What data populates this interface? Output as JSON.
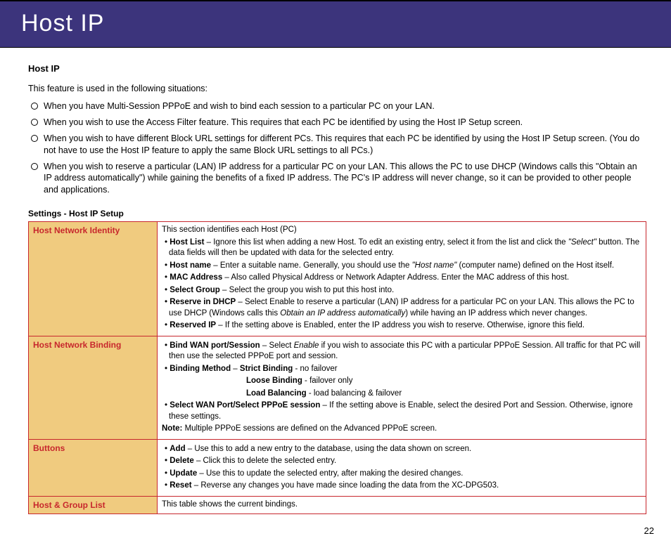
{
  "header": {
    "title": "Host IP"
  },
  "pageNumber": "22",
  "section": {
    "subhead": "Host IP",
    "intro": "This feature is used in the following situations:",
    "bullets": [
      "When you have Multi-Session PPPoE and wish to bind each session to a particular PC on your LAN.",
      "When you wish to use the Access Filter feature. This requires that each PC be identified by using the Host IP Setup screen.",
      "When you wish to have different Block URL settings for different PCs. This requires that each PC be identified by using the Host IP Setup screen. (You do not have to use the Host IP feature to apply the same Block URL settings to all PCs.)",
      "When you wish to reserve a particular (LAN) IP address for a particular PC on your LAN. This allows the PC to use DHCP (Windows calls this \"Obtain an IP address automatically\") while gaining the benefits of a fixed IP address. The PC's IP address will never change, so it can be provided to other people and applications."
    ],
    "tableTitle": "Settings - Host IP Setup"
  },
  "table": {
    "row1": {
      "label": "Host Network Identity",
      "lead": "This section identifies each Host (PC)",
      "hostList_label": "Host List",
      "hostList_sep": " – Ignore this list when adding a new Host. To edit an existing entry, select it from the list and click the ",
      "hostList_quote": "\"Select\"",
      "hostList_after": " button. The data fields will then be updated with data for the selected entry.",
      "hostName_label": "Host name",
      "hostName_sep": " – Enter a suitable name. Generally, you should use the ",
      "hostName_quote": "\"Host name\"",
      "hostName_after": " (computer name) defined on the Host itself.",
      "mac_label": "MAC Address",
      "mac_text": " – Also called Physical Address or Network Adapter Address. Enter the MAC address of this host.",
      "selGroup_label": "Select Group",
      "selGroup_text": " – Select the group you wish to put this host into.",
      "reserve_label": "Reserve in DHCP",
      "reserve_pre": " – Select Enable to reserve a particular (LAN) IP address for a particular PC on your LAN. This allows the PC to use DHCP (Windows calls this ",
      "reserve_italic": "Obtain an IP address automatically",
      "reserve_post": ") while having an IP address which never changes.",
      "reservedIP_label": "Reserved IP",
      "reservedIP_text": " – If the setting above is Enabled, enter the IP address you wish to reserve. Otherwise, ignore this field."
    },
    "row2": {
      "label": "Host Network Binding",
      "bind_label": "Bind WAN port/Session",
      "bind_pre": " – Select ",
      "bind_italic": "Enable",
      "bind_post": " if you wish to associate this PC with a particular PPPoE Session. All traffic for that PC will then use the selected PPPoE port and session.",
      "method_label": "Binding Method",
      "method_sep": " – ",
      "strict_label": "Strict Binding",
      "strict_text": " - no failover",
      "loose_label": "Loose Binding",
      "loose_text": " - failover only",
      "load_label": "Load Balancing",
      "load_text": " - load balancing & failover",
      "selWan_label": "Select WAN Port/Select PPPoE session",
      "selWan_text": " – If the setting above is Enable, select the desired Port and Session. Otherwise, ignore these settings.",
      "note_label": "Note:",
      "note_text": " Multiple PPPoE sessions are defined on the Advanced PPPoE screen."
    },
    "row3": {
      "label": "Buttons",
      "add_label": "Add",
      "add_text": " – Use this to add a new entry to the database, using the data shown on screen.",
      "del_label": "Delete",
      "del_text": " – Click this to delete the selected entry.",
      "upd_label": "Update",
      "upd_text": " – Use this to update the selected entry, after making the desired changes.",
      "rst_label": "Reset",
      "rst_text": " – Reverse any changes you have made since loading the data from the XC-DPG503."
    },
    "row4": {
      "label": "Host & Group List",
      "text": "This table shows the current bindings."
    }
  }
}
